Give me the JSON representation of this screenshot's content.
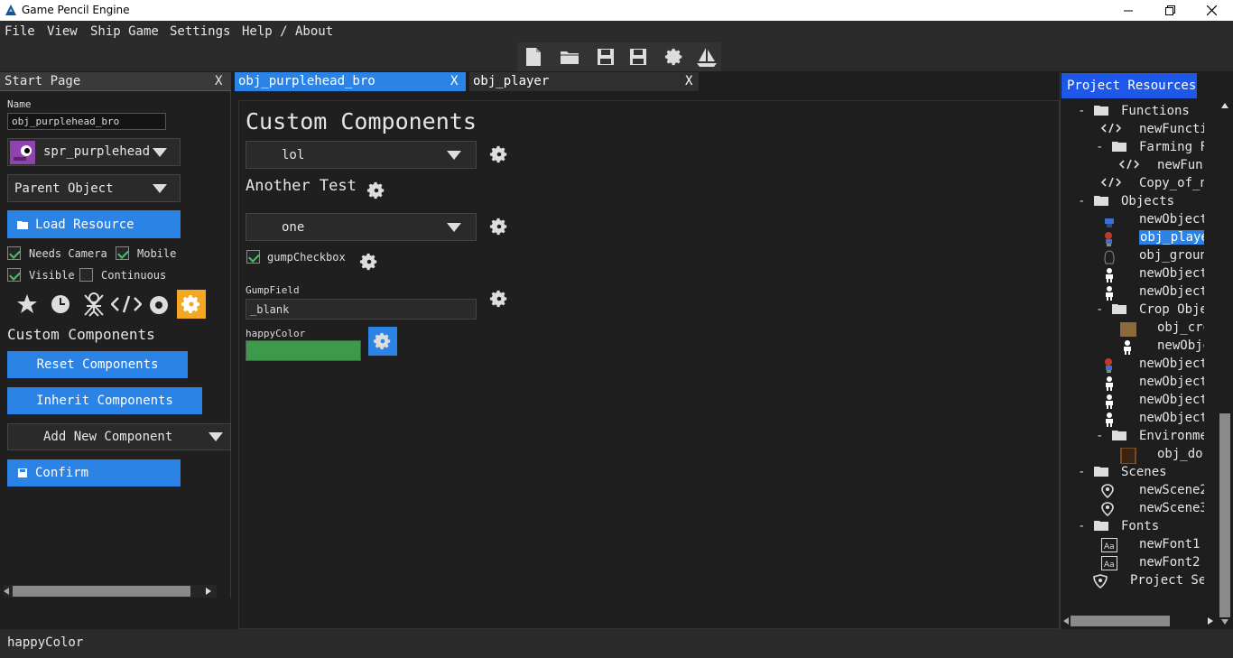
{
  "window": {
    "title": "Game Pencil Engine"
  },
  "menu": {
    "items": [
      "File",
      "View",
      "Ship Game",
      "Settings",
      "Help / About"
    ]
  },
  "left": {
    "tab_label": "Start Page",
    "close": "X",
    "name_label": "Name",
    "name_value": "obj_purplehead_bro",
    "sprite_label": "spr_purplehead",
    "parent_label": "Parent Object",
    "load_resource": "Load Resource",
    "needs_camera": "Needs Camera",
    "mobile": "Mobile",
    "visible": "Visible",
    "continuous": "Continuous",
    "custom_components": "Custom Components",
    "reset_components": "Reset Components",
    "inherit_components": "Inherit Components",
    "add_new_component": "Add New Component",
    "confirm": "Confirm"
  },
  "tabs": [
    {
      "label": "obj_purplehead_bro",
      "close": "X"
    },
    {
      "label": "obj_player",
      "close": "X"
    }
  ],
  "center": {
    "heading": "Custom Components",
    "dropdown1": "lol",
    "another_test": "Another Test",
    "dropdown2": "one",
    "gump_checkbox": "gumpCheckbox",
    "gump_field_label": "GumpField",
    "gump_field_value": "_blank",
    "happy_color_label": "happyColor",
    "happy_color_value": "#3c9a4a"
  },
  "resources": {
    "tab_label": "Project Resources",
    "items": [
      "Functions",
      "newFuncti",
      "Farming F",
      "newFunc",
      "Copy_of_n",
      "Objects",
      "newObject",
      "obj_playe",
      "obj_groun",
      "newObject",
      "newObject",
      "Crop Obje",
      "obj_cro",
      "newObje",
      "newObject",
      "newObject",
      "newObject",
      "newObject",
      "Environme",
      "obj_doc",
      "Scenes",
      "newScene2",
      "newScene3",
      "Fonts",
      "newFont1",
      "newFont2",
      "Project Setti"
    ]
  },
  "status": {
    "text": "happyColor"
  },
  "colors": {
    "accent": "#2b83e6",
    "resources_tab": "#1e58e8",
    "orange": "#f5a623"
  }
}
